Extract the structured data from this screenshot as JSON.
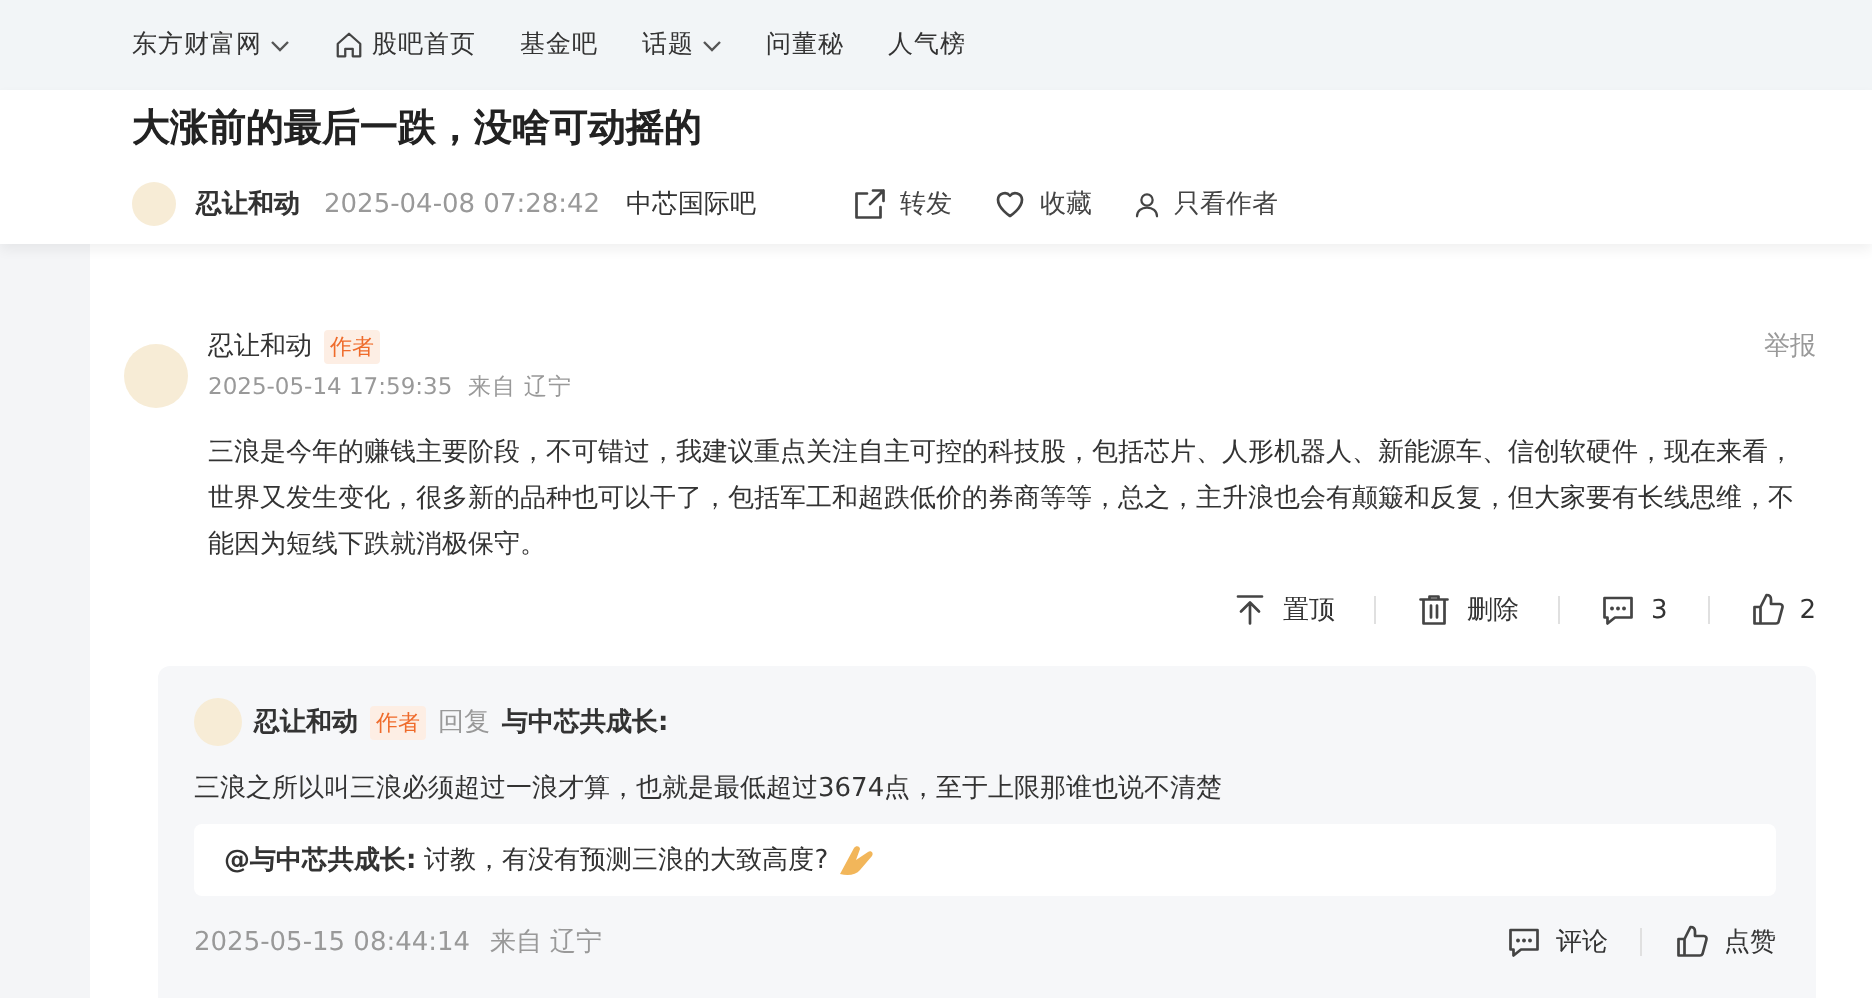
{
  "nav": {
    "items": [
      {
        "label": "东方财富网",
        "kind": "dropdown"
      },
      {
        "label": "股吧首页",
        "kind": "home"
      },
      {
        "label": "基金吧",
        "kind": "plain"
      },
      {
        "label": "话题",
        "kind": "dropdown"
      },
      {
        "label": "问董秘",
        "kind": "plain"
      },
      {
        "label": "人气榜",
        "kind": "plain"
      }
    ]
  },
  "post": {
    "title": "大涨前的最后一跌，没啥可动摇的",
    "author": "忍让和动",
    "time": "2025-04-08 07:28:42",
    "bar": "中芯国际吧",
    "actions": [
      {
        "label": "转发",
        "kind": "share"
      },
      {
        "label": "收藏",
        "kind": "favorite"
      },
      {
        "label": "只看作者",
        "kind": "author"
      }
    ]
  },
  "comment": {
    "author": "忍让和动",
    "badge": "作者",
    "report": "举报",
    "time": "2025-05-14 17:59:35",
    "location": "来自 辽宁",
    "body": "三浪是今年的赚钱主要阶段，不可错过，我建议重点关注自主可控的科技股，包括芯片、人形机器人、新能源车、信创软硬件，现在来看，世界又发生变化，很多新的品种也可以干了，包括军工和超跌低价的券商等等，总之，主升浪也会有颠簸和反复，但大家要有长线思维，不能因为短线下跌就消极保守。",
    "actions": [
      {
        "label": "置顶",
        "kind": "pin"
      },
      {
        "label": "删除",
        "kind": "delete"
      },
      {
        "label": "3",
        "kind": "comment"
      },
      {
        "label": "2",
        "kind": "like"
      }
    ],
    "reply": {
      "author": "忍让和动",
      "badge": "作者",
      "verb": "回复",
      "target": "与中芯共成长:",
      "body": "三浪之所以叫三浪必须超过一浪才算，也就是最低超过3674点，至于上限那谁也说不清楚",
      "quote": {
        "who": "@与中芯共成长:",
        "text": "讨教，有没有预测三浪的大致高度?"
      },
      "time": "2025-05-15 08:44:14",
      "location": "来自 辽宁",
      "actions": [
        {
          "label": "评论",
          "kind": "comment"
        },
        {
          "label": "点赞",
          "kind": "like"
        }
      ]
    }
  }
}
